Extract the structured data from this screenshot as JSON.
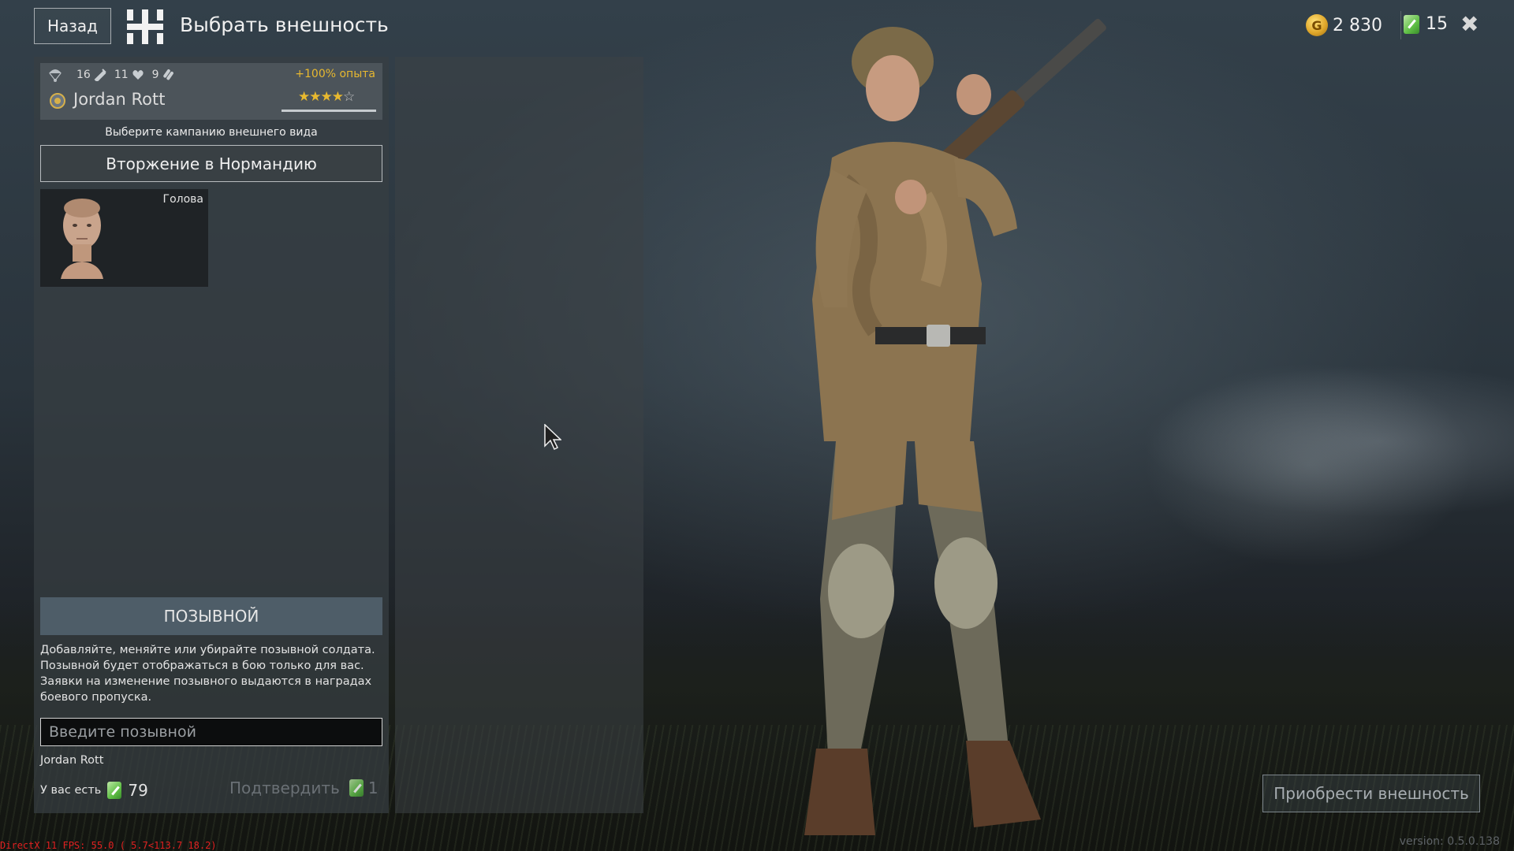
{
  "header": {
    "back_label": "Назад",
    "title": "Выбрать внешность",
    "gold_amount": "2 830",
    "gold_icon": "gold-coin-icon",
    "tickets_amount": "15",
    "tickets_icon": "appearance-ticket-icon",
    "close_icon": "close-icon"
  },
  "soldier_card": {
    "stat_1": "16",
    "stat_2": "11",
    "stat_3": "9",
    "xp_bonus": "+100% опыта",
    "name": "Jordan Rott",
    "stars_filled": "★★★★",
    "stars_empty": "☆",
    "rating": 4,
    "rating_max": 5
  },
  "campaign": {
    "hint": "Выберите кампанию внешнего вида",
    "selected": "Вторжение в Нормандию"
  },
  "head_slot": {
    "label": "Голова"
  },
  "callsign": {
    "header": "ПОЗЫВНОЙ",
    "description": "Добавляйте, меняйте или убирайте позывной солдата. Позывной будет отображаться в бою только для вас. Заявки на изменение позывного выдаются в наградах боевого пропуска.",
    "placeholder": "Введите позывной",
    "current": "Jordan Rott",
    "have_label": "У вас есть",
    "have_amount": "79",
    "confirm_label": "Подтвердить",
    "confirm_cost": "1"
  },
  "buy_label": "Приобрести внешность",
  "debug": "DirectX 11 FPS: 55.0 ( 5.7<113.7 18.2)",
  "version": "version: 0.5.0.138",
  "colors": {
    "accent_gold": "#e7b830",
    "ticket_green": "#5fbf45",
    "debug_red": "#e02020"
  }
}
